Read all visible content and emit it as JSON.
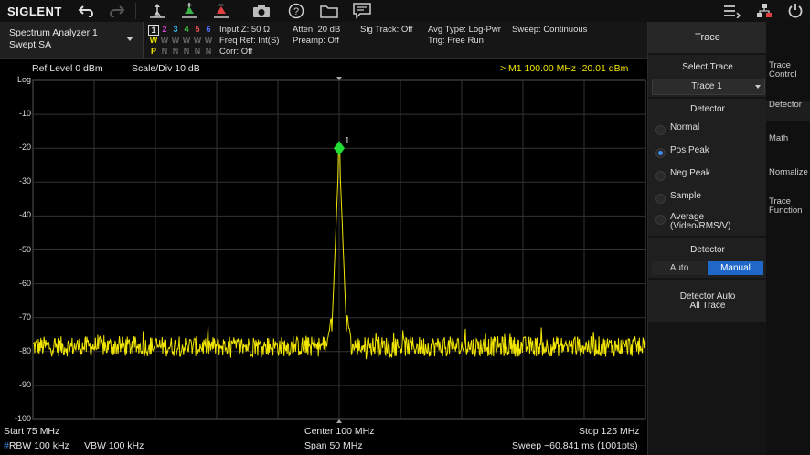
{
  "toolbar": {
    "brand": "SIGLENT",
    "icons": [
      "undo-icon",
      "redo-icon",
      "peak-search-icon",
      "marker-add-icon",
      "marker-delete-icon",
      "camera-icon",
      "help-icon",
      "folder-icon",
      "message-icon",
      "menu-lines-icon",
      "network-icon",
      "power-icon"
    ]
  },
  "status": {
    "mode_line1": "Spectrum Analyzer 1",
    "mode_line2": "Swept SA",
    "trace_numbers": [
      "1",
      "2",
      "3",
      "4",
      "5",
      "6"
    ],
    "trace_colors": [
      "#f2e600",
      "#d040d0",
      "#38b8f0",
      "#40d040",
      "#f05050",
      "#5070ff"
    ],
    "trace_w_row": [
      "W",
      "W",
      "W",
      "W",
      "W",
      "W"
    ],
    "trace_p_row": [
      "P",
      "N",
      "N",
      "N",
      "N",
      "N"
    ],
    "input_z": "Input Z: 50 Ω",
    "freq_ref": "Freq Ref: Int(S)",
    "corr": "Corr: Off",
    "atten": "Atten: 20 dB",
    "preamp": "Preamp: Off",
    "sig_track": "Sig Track: Off",
    "avg_type": "Avg Type: Log-Pwr",
    "trig": "Trig: Free Run",
    "sweep_mode": "Sweep: Continuous"
  },
  "panel": {
    "title": "Trace",
    "select_trace_title": "Select Trace",
    "select_trace_value": "Trace 1",
    "detector_title": "Detector",
    "detector_options": [
      "Normal",
      "Pos Peak",
      "Neg Peak",
      "Sample",
      "Average\n(Video/RMS/V)"
    ],
    "detector_selected": 1,
    "detector_mode_title": "Detector",
    "detector_auto": "Auto",
    "detector_manual": "Manual",
    "detector_auto_all_l1": "Detector Auto",
    "detector_auto_all_l2": "All Trace"
  },
  "tabs": [
    "Trace Control",
    "Detector",
    "Math",
    "Normalize",
    "Trace Function"
  ],
  "plot": {
    "ref_level": "Ref Level  0 dBm",
    "scale": "Scale/Div  10 dB",
    "marker_readout": "> M1    100.00 MHz   -20.01 dBm",
    "marker_label": "1",
    "y_labels": [
      "Log",
      "-10",
      "-20",
      "-30",
      "-40",
      "-50",
      "-60",
      "-70",
      "-80",
      "-90",
      "-100"
    ],
    "start": "Start  75 MHz",
    "center": "Center  100 MHz",
    "stop": "Stop  125 MHz",
    "rbw": "#RBW  100 kHz",
    "vbw": "VBW  100 kHz",
    "span": "Span  50 MHz",
    "sweep_time": "Sweep  ~60.841 ms (1001pts)"
  },
  "chart_data": {
    "type": "line",
    "x_start_mhz": 75,
    "x_stop_mhz": 125,
    "ylim": [
      -100,
      0
    ],
    "noise_floor_dbm": -78.5,
    "peak": {
      "x_mhz": 100.0,
      "y_dbm": -20.01
    },
    "trace_color": "#f2e600",
    "grid": true
  }
}
